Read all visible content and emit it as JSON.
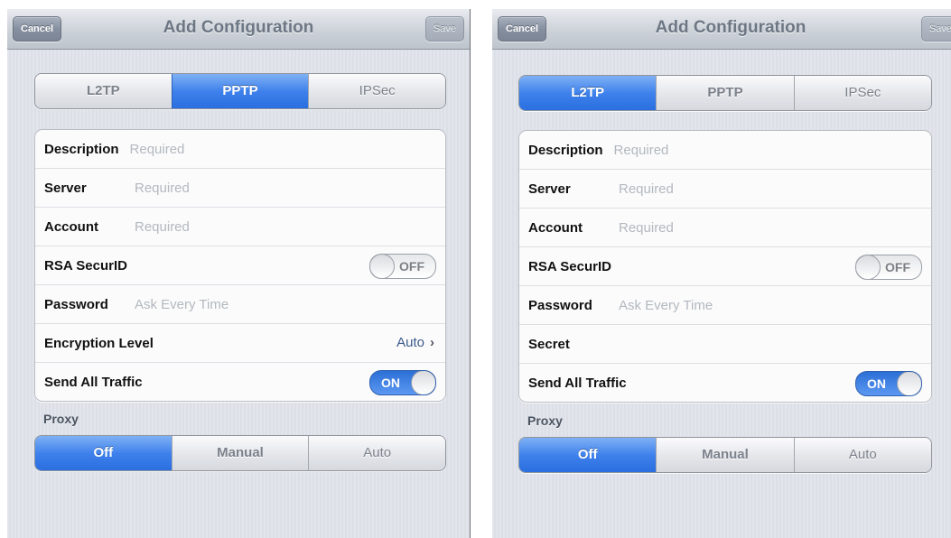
{
  "left": {
    "nav": {
      "cancel": "Cancel",
      "title": "Add Configuration",
      "save": "Save"
    },
    "vpn_types": [
      "L2TP",
      "PPTP",
      "IPSec"
    ],
    "rows": {
      "description": {
        "label": "Description",
        "placeholder": "Required"
      },
      "server": {
        "label": "Server",
        "placeholder": "Required"
      },
      "account": {
        "label": "Account",
        "placeholder": "Required"
      },
      "rsa": {
        "label": "RSA SecurID",
        "state": "OFF"
      },
      "password": {
        "label": "Password",
        "placeholder": "Ask Every Time"
      },
      "encryption": {
        "label": "Encryption Level",
        "value": "Auto"
      },
      "send_all": {
        "label": "Send All Traffic",
        "state": "ON"
      }
    },
    "proxy": {
      "label": "Proxy",
      "options": [
        "Off",
        "Manual",
        "Auto"
      ]
    }
  },
  "right": {
    "nav": {
      "cancel": "Cancel",
      "title": "Add Configuration",
      "save": "Save"
    },
    "vpn_types": [
      "L2TP",
      "PPTP",
      "IPSec"
    ],
    "rows": {
      "description": {
        "label": "Description",
        "placeholder": "Required"
      },
      "server": {
        "label": "Server",
        "placeholder": "Required"
      },
      "account": {
        "label": "Account",
        "placeholder": "Required"
      },
      "rsa": {
        "label": "RSA SecurID",
        "state": "OFF"
      },
      "password": {
        "label": "Password",
        "placeholder": "Ask Every Time"
      },
      "secret": {
        "label": "Secret"
      },
      "send_all": {
        "label": "Send All Traffic",
        "state": "ON"
      }
    },
    "proxy": {
      "label": "Proxy",
      "options": [
        "Off",
        "Manual",
        "Auto"
      ]
    }
  },
  "colors": {
    "accent": "#3f82ec",
    "value_blue": "#3c5a8c",
    "placeholder": "#b3b8bf"
  }
}
